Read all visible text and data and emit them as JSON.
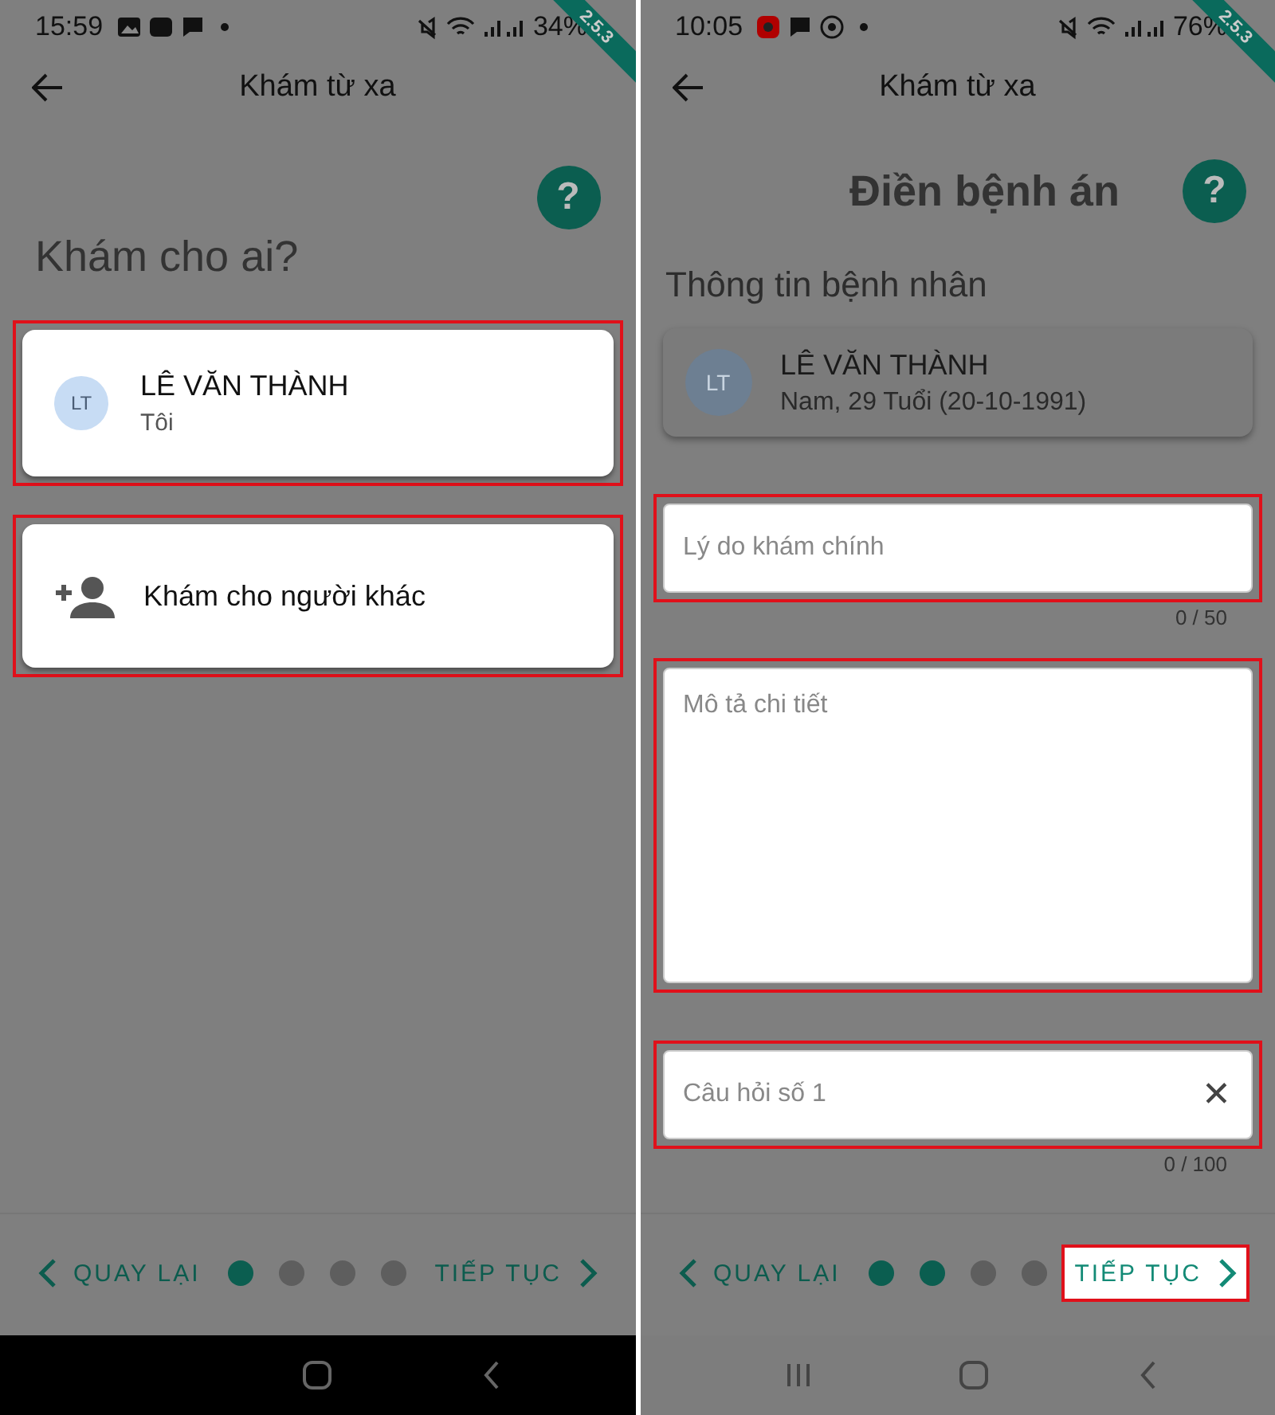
{
  "phones": [
    {
      "kind": "chooser",
      "status_bar": {
        "time": "15:59",
        "battery": "34%"
      },
      "ribbon": "2.5.3",
      "app_bar": {
        "title": "Khám từ xa"
      },
      "help": "?",
      "heading": "Khám cho ai?",
      "items": [
        {
          "kind": "person-card",
          "initials": "LT",
          "name": "LÊ VĂN THÀNH",
          "subtitle": "Tôi",
          "highlighted": true
        },
        {
          "kind": "add-card",
          "label": "Khám cho người khác",
          "highlighted": true
        }
      ],
      "footer": {
        "back": "QUAY LẠI",
        "next": "TIẾP TỤC",
        "next_highlighted": false,
        "steps": [
          {
            "done": true
          },
          {
            "done": false
          },
          {
            "done": false
          },
          {
            "done": false
          }
        ]
      }
    },
    {
      "kind": "form",
      "status_bar": {
        "time": "10:05",
        "battery": "76%"
      },
      "ribbon": "2.5.3",
      "app_bar": {
        "title": "Khám từ xa"
      },
      "help": "?",
      "heading": "Điền bệnh án",
      "items": [
        {
          "kind": "section-title",
          "text": "Thông tin bệnh nhân"
        },
        {
          "kind": "patient-card",
          "initials": "LT",
          "name": "LÊ VĂN THÀNH",
          "subtitle": "Nam, 29 Tuổi (20-10-1991)",
          "highlighted": false
        },
        {
          "kind": "field",
          "placeholder": "Lý do khám chính",
          "counter": "0 / 50",
          "highlighted": true
        },
        {
          "kind": "textarea",
          "placeholder": "Mô tả chi tiết",
          "highlighted": true
        },
        {
          "kind": "clearable-field",
          "placeholder": "Câu hỏi số 1",
          "clear": "✕",
          "counter": "0 / 100",
          "highlighted": true
        }
      ],
      "footer": {
        "back": "QUAY LẠI",
        "next": "TIẾP TỤC",
        "next_highlighted": true,
        "steps": [
          {
            "done": true
          },
          {
            "done": true
          },
          {
            "done": false
          },
          {
            "done": false
          }
        ]
      }
    }
  ]
}
